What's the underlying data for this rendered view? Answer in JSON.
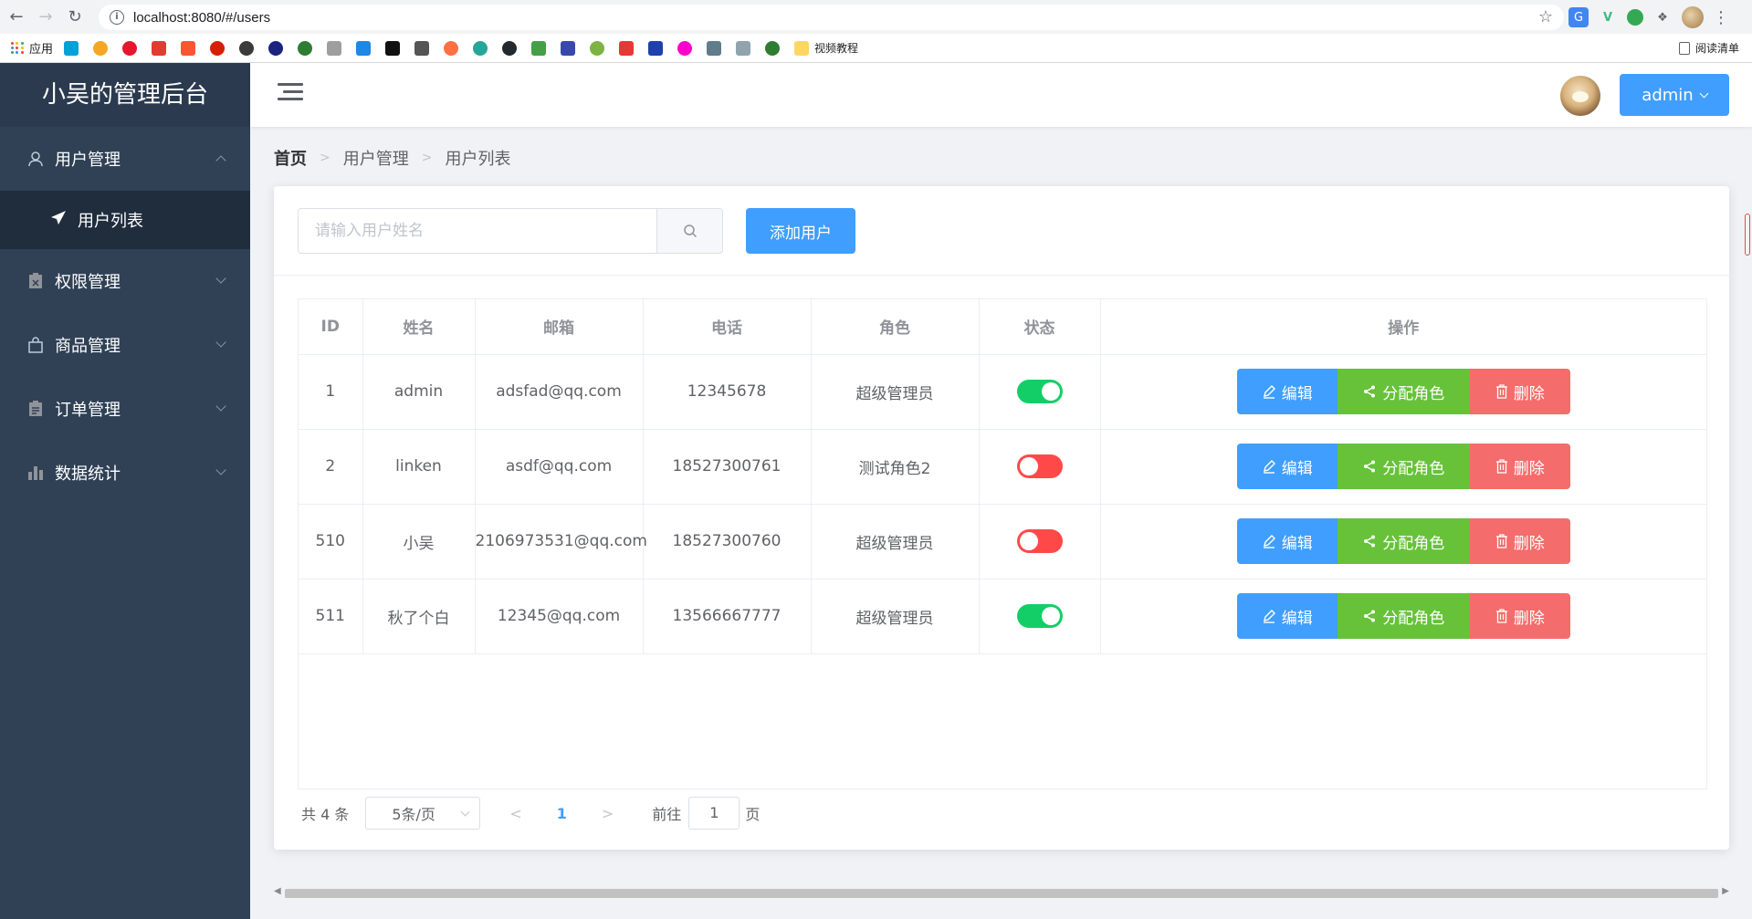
{
  "browser": {
    "url": "localhost:8080/#/users",
    "bookmarks_apps_label": "应用",
    "bookmark_folder_label": "视频教程",
    "reading_list_label": "阅读清单"
  },
  "sidebar": {
    "logo": "小吴的管理后台",
    "menu": [
      {
        "label": "用户管理",
        "icon": "user-icon",
        "expanded": true
      },
      {
        "label": "权限管理",
        "icon": "clipboard-icon",
        "expanded": false
      },
      {
        "label": "商品管理",
        "icon": "shopping-bag-icon",
        "expanded": false
      },
      {
        "label": "订单管理",
        "icon": "document-icon",
        "expanded": false
      },
      {
        "label": "数据统计",
        "icon": "bar-chart-icon",
        "expanded": false
      }
    ],
    "submenu": [
      {
        "label": "用户列表",
        "icon": "paper-plane-icon",
        "active": true
      }
    ]
  },
  "header": {
    "admin_label": "admin"
  },
  "breadcrumb": {
    "home": "首页",
    "level1": "用户管理",
    "level2": "用户列表"
  },
  "toolbar": {
    "search_placeholder": "请输入用户姓名",
    "search_value": "",
    "add_label": "添加用户"
  },
  "table": {
    "headers": [
      "ID",
      "姓名",
      "邮箱",
      "电话",
      "角色",
      "状态",
      "操作"
    ],
    "rows": [
      {
        "id": "1",
        "name": "admin",
        "email": "adsfad@qq.com",
        "phone": "12345678",
        "role": "超级管理员",
        "status": true
      },
      {
        "id": "2",
        "name": "linken",
        "email": "asdf@qq.com",
        "phone": "18527300761",
        "role": "测试角色2",
        "status": false
      },
      {
        "id": "510",
        "name": "小吴",
        "email": "2106973531@qq.com",
        "phone": "18527300760",
        "role": "超级管理员",
        "status": false
      },
      {
        "id": "511",
        "name": "秋了个白",
        "email": "12345@qq.com",
        "phone": "13566667777",
        "role": "超级管理员",
        "status": true
      }
    ],
    "actions": {
      "edit": "编辑",
      "assign_role": "分配角色",
      "delete": "删除"
    }
  },
  "pagination": {
    "total_text": "共 4 条",
    "page_size": "5条/页",
    "current_page": "1",
    "goto_label": "前往",
    "goto_value": "1",
    "goto_unit": "页"
  },
  "colors": {
    "primary": "#409eff",
    "success": "#67c23a",
    "danger": "#f56c6c",
    "switch_on": "#13ce66",
    "switch_off": "#ff4949",
    "sidebar_bg": "#304156"
  }
}
